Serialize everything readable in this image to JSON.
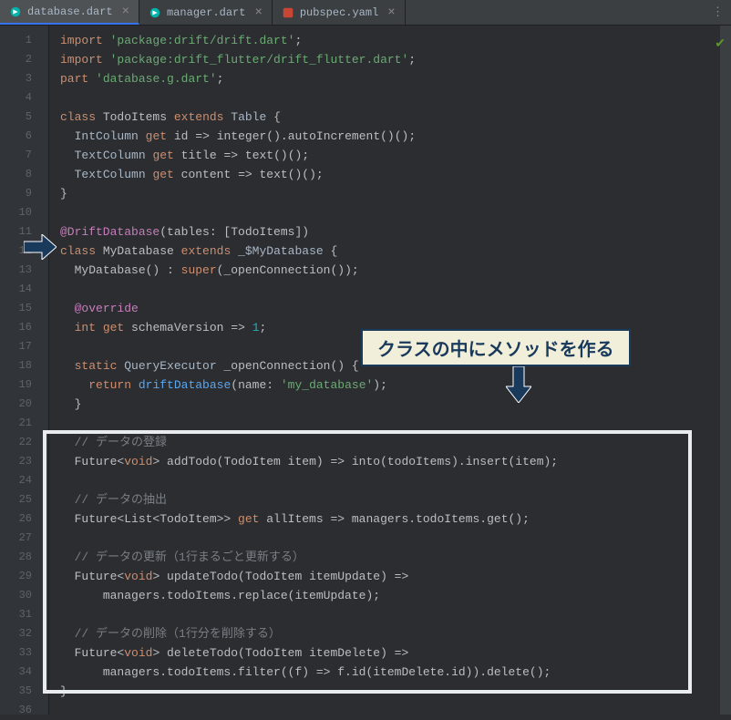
{
  "tabs": [
    {
      "name": "database.dart",
      "icon": "dart"
    },
    {
      "name": "manager.dart",
      "icon": "dart"
    },
    {
      "name": "pubspec.yaml",
      "icon": "yaml"
    }
  ],
  "active_tab": 0,
  "callout": "クラスの中にメソッドを作る",
  "lines": {
    "import1_kw": "import",
    "import1_str": "'package:drift/drift.dart'",
    "import2_kw": "import",
    "import2_str": "'package:drift_flutter/drift_flutter.dart'",
    "part_kw": "part",
    "part_str": "'database.g.dart'",
    "class1_kw": "class",
    "class1_name": "TodoItems",
    "class1_ext": "extends",
    "class1_super": "Table",
    "id_line_type": "IntColumn",
    "id_line_get": "get",
    "id_line_name": "id",
    "id_line_body": "integer().autoIncrement()()",
    "title_line_type": "TextColumn",
    "title_line_get": "get",
    "title_line_name": "title",
    "title_line_body": "text()()",
    "content_line_type": "TextColumn",
    "content_line_get": "get",
    "content_line_name": "content",
    "content_line_body": "text()()",
    "anno": "@DriftDatabase",
    "anno_body": "(tables: [TodoItems])",
    "class2_kw": "class",
    "class2_name": "MyDatabase",
    "class2_ext": "extends",
    "class2_super": "_$MyDatabase",
    "ctor": "MyDatabase() : ",
    "ctor_super": "super",
    "ctor_body": "(_openConnection());",
    "override": "@override",
    "sv_type": "int",
    "sv_get": "get",
    "sv_name": "schemaVersion",
    "sv_val": "1",
    "static_kw": "static",
    "oc_type": "QueryExecutor",
    "oc_name": "_openConnection",
    "ret_kw": "return",
    "ret_call": "driftDatabase",
    "ret_arg": "(name: ",
    "ret_str": "'my_database'",
    "c_add": "// データの登録",
    "l_add_pre": "Future<",
    "l_add_void": "void",
    "l_add_post": "> addTodo(TodoItem item) => into(todoItems).insert(item);",
    "c_get": "// データの抽出",
    "l_get": "Future<List<TodoItem>> ",
    "l_get_kw": "get",
    "l_get_post": " allItems => managers.todoItems.get();",
    "c_upd": "// データの更新（1行まるごと更新する）",
    "l_upd_pre": "Future<",
    "l_upd_void": "void",
    "l_upd_post": "> updateTodo(TodoItem itemUpdate) =>",
    "l_upd2": "managers.todoItems.replace(itemUpdate);",
    "c_del": "// データの削除（1行分を削除する）",
    "l_del_pre": "Future<",
    "l_del_void": "void",
    "l_del_post": "> deleteTodo(TodoItem itemDelete) =>",
    "l_del2": "managers.todoItems.filter((f) => f.id(itemDelete.id)).delete();"
  },
  "line_numbers": [
    "1",
    "2",
    "3",
    "4",
    "5",
    "6",
    "7",
    "8",
    "9",
    "10",
    "11",
    "12",
    "13",
    "14",
    "15",
    "16",
    "17",
    "18",
    "19",
    "20",
    "21",
    "22",
    "23",
    "24",
    "25",
    "26",
    "27",
    "28",
    "29",
    "30",
    "31",
    "32",
    "33",
    "34",
    "35",
    "36"
  ]
}
